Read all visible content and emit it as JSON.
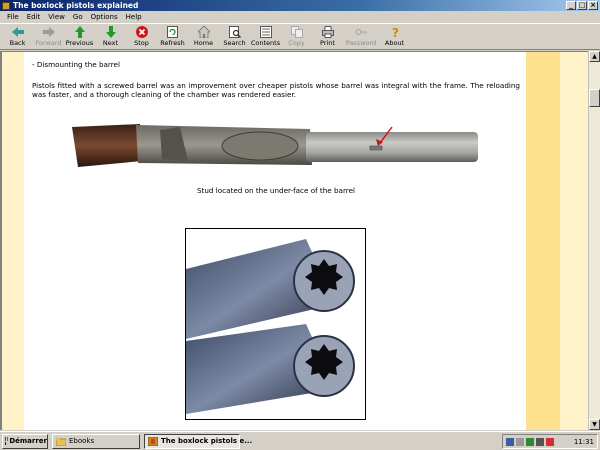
{
  "window": {
    "title": "The boxlock pistols explained",
    "buttons": [
      "_",
      "□",
      "×"
    ]
  },
  "menu": [
    "File",
    "Edit",
    "View",
    "Go",
    "Options",
    "Help"
  ],
  "toolbar": [
    {
      "label": "Back",
      "icon": "back-arrow-icon",
      "enabled": true
    },
    {
      "label": "Forward",
      "icon": "forward-arrow-icon",
      "enabled": false
    },
    {
      "label": "Previous",
      "icon": "up-arrow-icon",
      "enabled": true
    },
    {
      "label": "Next",
      "icon": "down-arrow-icon",
      "enabled": true
    },
    {
      "label": "Stop",
      "icon": "stop-icon",
      "enabled": true
    },
    {
      "label": "Refresh",
      "icon": "refresh-icon",
      "enabled": true
    },
    {
      "label": "Home",
      "icon": "home-icon",
      "enabled": true
    },
    {
      "label": "Search",
      "icon": "search-icon",
      "enabled": true
    },
    {
      "label": "Contents",
      "icon": "contents-icon",
      "enabled": true
    },
    {
      "label": "Copy",
      "icon": "copy-icon",
      "enabled": false
    },
    {
      "label": "Print",
      "icon": "print-icon",
      "enabled": true
    },
    {
      "label": "Password",
      "icon": "key-icon",
      "enabled": false
    },
    {
      "label": "About",
      "icon": "question-icon",
      "enabled": true
    }
  ],
  "article": {
    "heading": "- Dismounting the barrel",
    "paragraph": "Pistols fitted with a screwed barrel was an improvement over cheaper pistols whose barrel was integral with the frame. The reloading was faster, and a thorough cleaning of the chamber was rendered easier.",
    "caption": "Stud located on the under-face of the barrel"
  },
  "taskbar": {
    "start_label": "Démarrer",
    "tasks": [
      {
        "label": "Ebooks",
        "active": false
      },
      {
        "label": "The boxlock pistols e...",
        "active": true
      }
    ],
    "clock": "11:31"
  },
  "colors": {
    "stripe_light": "#fff1c8",
    "stripe_dark": "#fde18f",
    "titlebar": "#0a246a"
  }
}
